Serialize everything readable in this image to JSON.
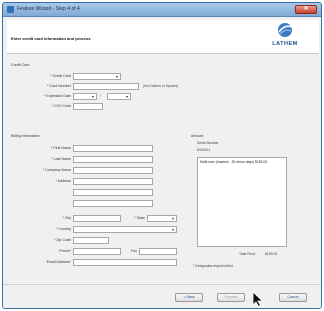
{
  "window": {
    "title": "Feature Wizard - Step 4 of 4",
    "close_label": "✕"
  },
  "header": {
    "title": "Enter credit card information and process",
    "logo_text": "LATHEM",
    "logo_icon": "globe-swoosh-icon",
    "brand_color": "#1b4f8a"
  },
  "credit_card": {
    "section_label": "Credit Card",
    "type_label": "* Credit Card",
    "type_value": "",
    "number_label": "* Card Number",
    "number_value": "",
    "number_note": "(No Dashes or Spaces)",
    "expiration_label": "* Expiration Date",
    "expiration_separator": "/",
    "month_value": "",
    "year_value": "",
    "cvv_label": "* CVV Code",
    "cvv_value": ""
  },
  "billing": {
    "section_label": "Billing Information",
    "first_name_label": "* First Name",
    "last_name_label": "* Last Name",
    "company_label": "* Company Name",
    "address_label": "* Address",
    "city_label": "* City",
    "state_label": "* State",
    "country_label": "* Country",
    "zip_label": "* Zip Code",
    "phone_label": "Phone*",
    "fax_label": "Fax",
    "email_label": "Email Address*"
  },
  "amount": {
    "section_label": "Amount",
    "serial_label": "Serial Number",
    "serial_value": "8400101",
    "items": [
      "Multi-user (Inactive - 30 demo days) $159.00"
    ],
    "total_label": "Total Price:",
    "total_value": "$159.00",
    "required_note": "* Designates required field"
  },
  "footer": {
    "back_label": "< Back",
    "process_label": "Process",
    "cancel_label": "Cancel"
  }
}
